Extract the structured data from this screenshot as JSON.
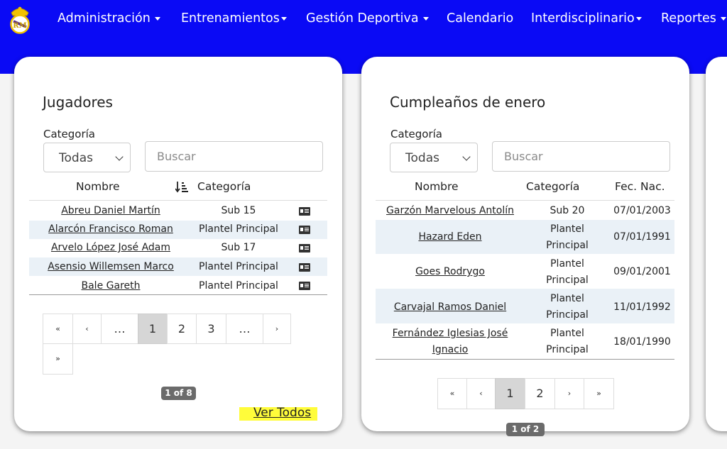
{
  "nav": {
    "items": [
      {
        "label": "Administración",
        "caret": true
      },
      {
        "label": "Entrenamientos",
        "caret": true
      },
      {
        "label": "Gestión Deportiva",
        "caret": true
      },
      {
        "label": "Calendario",
        "caret": false
      },
      {
        "label": "Interdisciplinario",
        "caret": true
      },
      {
        "label": "Reportes",
        "caret": true
      }
    ],
    "colors": {
      "bar": "#0a0af5",
      "text": "#ffffff"
    }
  },
  "players": {
    "title": "Jugadores",
    "category_label": "Categoría",
    "category_value": "Todas",
    "search_placeholder": "Buscar",
    "columns": {
      "name": "Nombre",
      "category": "Categoría"
    },
    "rows": [
      {
        "name": "Abreu Daniel Martín",
        "category": "Sub 15"
      },
      {
        "name": "Alarcón Francisco Roman",
        "category": "Plantel Principal"
      },
      {
        "name": "Arvelo López José Adam",
        "category": "Sub 17"
      },
      {
        "name": "Asensio Willemsen Marco",
        "category": "Plantel Principal"
      },
      {
        "name": "Bale Gareth",
        "category": "Plantel Principal"
      }
    ],
    "pagination": {
      "first": "«",
      "prev": "‹",
      "ellipsis": "…",
      "pages": [
        "1",
        "2",
        "3"
      ],
      "next": "›",
      "last": "»",
      "current": "1"
    },
    "page_badge": "1 of 8",
    "view_all": "Ver Todos"
  },
  "birthdays": {
    "title": "Cumpleaños de enero",
    "category_label": "Categoría",
    "category_value": "Todas",
    "search_placeholder": "Buscar",
    "columns": {
      "name": "Nombre",
      "category": "Categoría",
      "dob": "Fec. Nac."
    },
    "rows": [
      {
        "name": "Garzón Marvelous Antolín",
        "category": "Sub 20",
        "dob": "07/01/2003"
      },
      {
        "name": "Hazard Eden",
        "category": "Plantel Principal",
        "dob": "07/01/1991"
      },
      {
        "name": "Goes Rodrygo",
        "category": "Plantel Principal",
        "dob": "09/01/2001"
      },
      {
        "name": "Carvajal Ramos Daniel",
        "category": "Plantel Principal",
        "dob": "11/01/1992"
      },
      {
        "name": "Fernández Iglesias José Ignacio",
        "category": "Plantel Principal",
        "dob": "18/01/1990"
      }
    ],
    "pagination": {
      "first": "«",
      "prev": "‹",
      "pages": [
        "1",
        "2"
      ],
      "next": "›",
      "last": "»",
      "current": "1"
    },
    "page_badge": "1 of 2"
  },
  "icons": {
    "logo": "club-crest-icon",
    "sort": "sort-alpha-down-icon",
    "id_card": "id-card-icon"
  }
}
